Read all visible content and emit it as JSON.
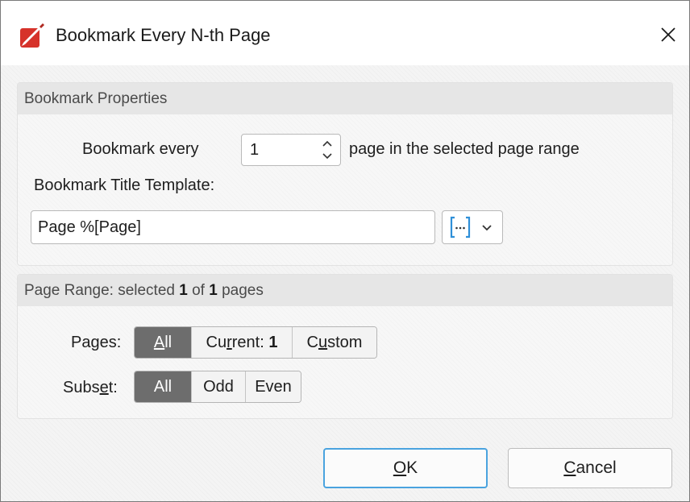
{
  "window": {
    "title": "Bookmark Every N-th Page",
    "app_icon": "pdf-xchange-logo",
    "close_glyph": "✕"
  },
  "bookmark_properties": {
    "header": "Bookmark Properties",
    "bookmark_every_label": "Bookmark every",
    "interval_value": "1",
    "suffix_label": "page in the selected page range",
    "title_template_label": "Bookmark Title Template:",
    "title_template_value": "Page %[Page]",
    "macro_button_icon": "macro-brackets-icon",
    "macro_dropdown_icon": "chevron-down-icon"
  },
  "page_range": {
    "header_prefix": "Page Range: selected ",
    "selected_count": "1",
    "header_middle": " of ",
    "total_count": "1",
    "header_suffix": " pages",
    "pages_label": "Pages:",
    "pages_label_pre": "Pages",
    "pages_options": [
      {
        "pre": "",
        "mn": "A",
        "post": "ll",
        "selected": true
      },
      {
        "pre": "Cu",
        "mn": "r",
        "post": "rent: ",
        "bold": "1",
        "selected": false
      },
      {
        "pre": "C",
        "mn": "u",
        "post": "stom",
        "selected": false
      }
    ],
    "subset_label_pre": "Subs",
    "subset_label_mn": "e",
    "subset_label_post": "t:",
    "subset_options": [
      {
        "label": "All",
        "selected": true
      },
      {
        "label": "Odd",
        "selected": false
      },
      {
        "label": "Even",
        "selected": false
      }
    ]
  },
  "footer": {
    "ok_mn": "O",
    "ok_rest": "K",
    "cancel_mn": "C",
    "cancel_rest": "ancel"
  },
  "colors": {
    "accent_blue": "#4aa3df",
    "selected_segment": "#6d6d6d",
    "logo_red": "#d6322a"
  }
}
